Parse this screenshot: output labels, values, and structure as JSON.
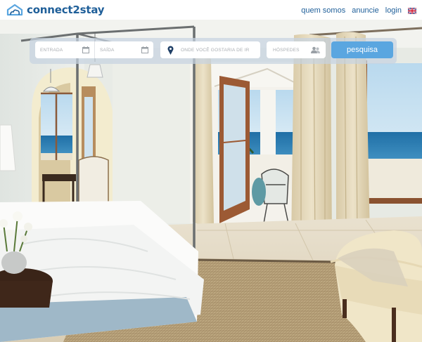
{
  "brand": {
    "name": "connect2stay",
    "logo_icon": "house-cloud-icon",
    "color": "#1f5f99"
  },
  "nav": {
    "links": [
      "quem somos",
      "anuncie",
      "login"
    ],
    "language_icon": "uk-flag-icon"
  },
  "search": {
    "checkin_placeholder": "ENTRADA",
    "checkout_placeholder": "SAÍDA",
    "destination_placeholder": "ONDE VOCÊ GOSTARIA DE IR",
    "guests_placeholder": "HÓSPEDES",
    "submit_label": "pesquisa",
    "accent": "#5aa6e0"
  },
  "hero": {
    "icon": "bedroom-ocean-view-photo"
  }
}
